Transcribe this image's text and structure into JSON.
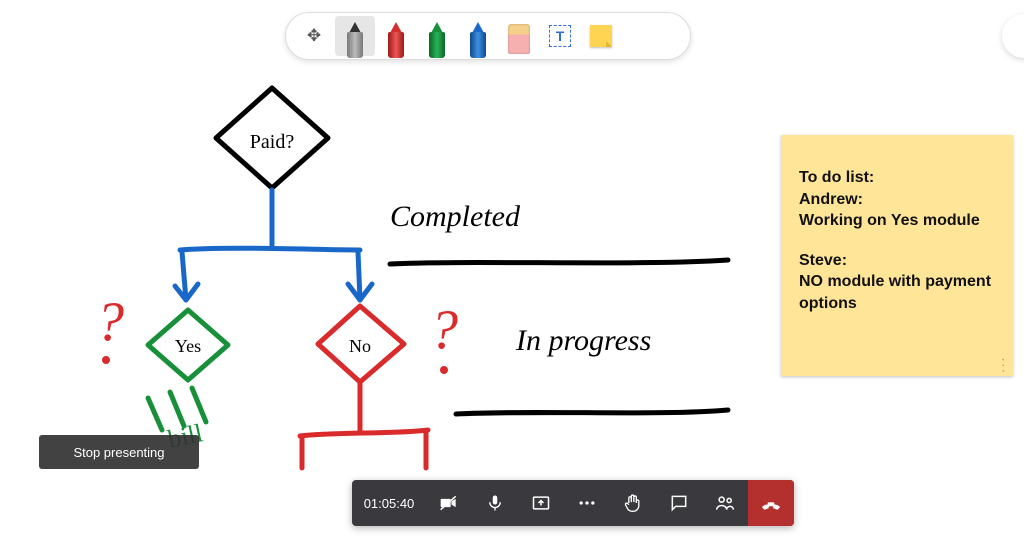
{
  "toolbar": {
    "tools": [
      {
        "name": "move-tool",
        "icon": "move",
        "selected": false
      },
      {
        "name": "pen-black",
        "icon": "pen",
        "color": "black",
        "selected": true
      },
      {
        "name": "pen-red",
        "icon": "pen",
        "color": "red",
        "selected": false
      },
      {
        "name": "pen-green",
        "icon": "pen",
        "color": "green",
        "selected": false
      },
      {
        "name": "pen-blue",
        "icon": "pen",
        "color": "blue",
        "selected": false
      },
      {
        "name": "eraser",
        "icon": "eraser",
        "selected": false
      },
      {
        "name": "text-tool",
        "icon": "text",
        "glyph": "T",
        "selected": false
      },
      {
        "name": "sticky-note-tool",
        "icon": "note",
        "selected": false
      }
    ]
  },
  "flowchart": {
    "decision": "Paid?",
    "yes_label": "Yes",
    "no_label": "No",
    "long_labels": {
      "completed": "Completed",
      "in_progress": "In progress"
    },
    "annotation_bill": "bill"
  },
  "sticky_note": {
    "heading": "To do list:",
    "line1": "Andrew:",
    "line2": "Working on Yes module",
    "line3": "Steve:",
    "line4": "NO module with payment options"
  },
  "presenting": {
    "stop_label": "Stop presenting"
  },
  "meeting_bar": {
    "timer": "01:05:40",
    "buttons": [
      {
        "name": "camera-toggle",
        "icon": "camera-off"
      },
      {
        "name": "mic-toggle",
        "icon": "microphone"
      },
      {
        "name": "share-screen",
        "icon": "share"
      },
      {
        "name": "more-actions",
        "icon": "dots"
      },
      {
        "name": "raise-hand",
        "icon": "hand"
      },
      {
        "name": "chat",
        "icon": "chat"
      },
      {
        "name": "participants",
        "icon": "people"
      },
      {
        "name": "hang-up",
        "icon": "phone-down"
      }
    ]
  }
}
